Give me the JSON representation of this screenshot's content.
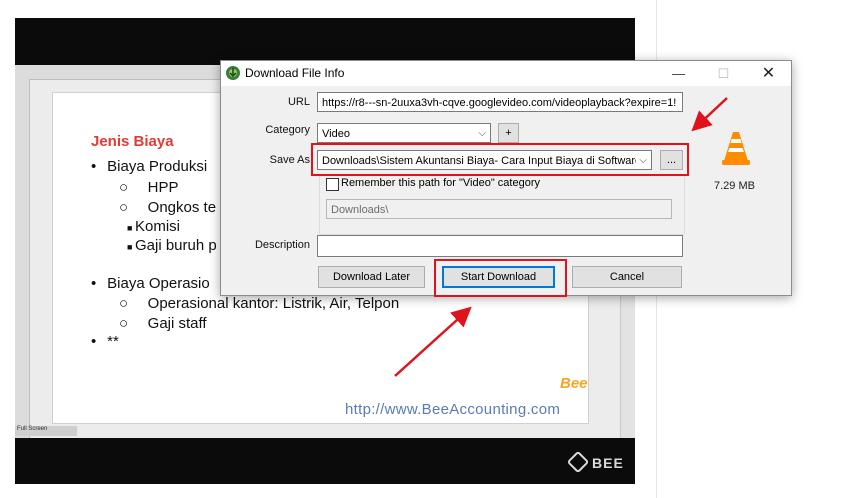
{
  "background_video": {
    "slide_title": "Jenis Biaya",
    "bullets": [
      {
        "marker": "•",
        "text": "Biaya Produksi"
      },
      {
        "marker": "○",
        "text": "HPP"
      },
      {
        "marker": "○",
        "text": "Ongkos te"
      },
      {
        "marker": "■",
        "text": "Komisi"
      },
      {
        "marker": "■",
        "text": "Gaji buruh p"
      },
      {
        "marker": "•",
        "text": "Biaya Operasio"
      },
      {
        "marker": "○",
        "text": "Operasional kantor: Listrik, Air, Telpon"
      },
      {
        "marker": "○",
        "text": "Gaji staff"
      },
      {
        "marker": "•",
        "text": "**"
      }
    ],
    "watermark_url": "http://www.BeeAccounting.com",
    "bee_mark": "Bee",
    "fullscreen_label": "Full Screen",
    "player_logo": "BEE"
  },
  "dialog": {
    "title": "Download File Info",
    "window_buttons": {
      "minimize": "—",
      "maximize": "☐",
      "close": "✕"
    },
    "url_label": "URL",
    "url_value": "https://r8---sn-2uuxa3vh-cqve.googlevideo.com/videoplayback?expire=1!",
    "category_label": "Category",
    "category_value": "Video",
    "add_category": "+",
    "save_as_label": "Save As",
    "save_as_value": "Downloads\\Sistem Akuntansi Biaya- Cara Input Biaya di Software",
    "browse": "...",
    "remember_label": "Remember this path for \"Video\" category",
    "remember_checked": false,
    "default_path": "Downloads\\",
    "description_label": "Description",
    "description_value": "",
    "file_size": "7.29  MB",
    "file_icon": "vlc-cone-icon",
    "buttons": {
      "download_later": "Download Later",
      "start_download": "Start Download",
      "cancel": "Cancel"
    }
  },
  "annotation_color": "#e0121b"
}
